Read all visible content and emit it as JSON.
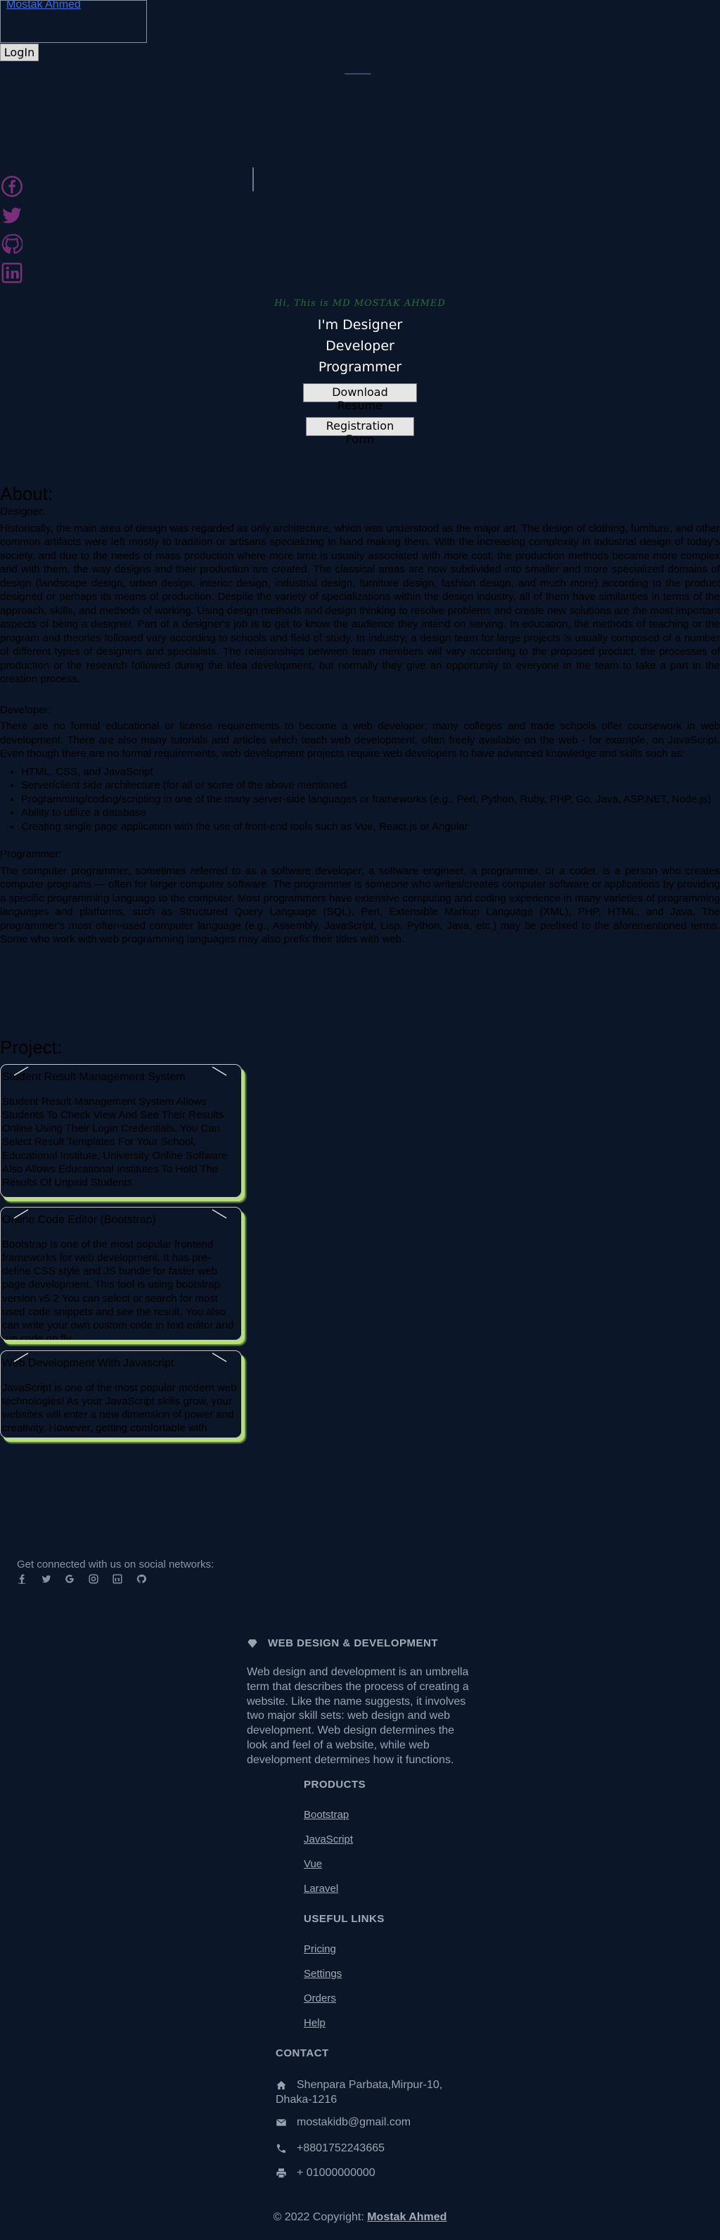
{
  "header": {
    "brand_link": "Mostak Ahmed",
    "login_label": "LogIn"
  },
  "hero": {
    "name_tagline": "Hi, This is MD MOSTAK AHMED",
    "roles": [
      "I'm Designer",
      "Developer",
      "Programmer"
    ],
    "download_resume_label": "Download Resume",
    "registration_form_label": "Registration Form"
  },
  "side_socials": [
    "facebook-icon",
    "twitter-icon",
    "github-icon",
    "linkedin-icon"
  ],
  "about": {
    "title": "About:",
    "designer_heading": "Designer:",
    "designer_text": "Historically, the main area of design was regarded as only architecture, which was understood as the major art. The design of clothing, furniture, and other common artifacts were left mostly to tradition or artisans specializing in hand making them. With the increasing complexity in industrial design of today's society, and due to the needs of mass production where more time is usually associated with more cost, the production methods became more complex and with them, the way designs and their production are created. The classical areas are now subdivided into smaller and more specialized domains of design (landscape design, urban design, interior design, industrial design, furniture design, fashion design, and much more) according to the product designed or perhaps its means of production. Despite the variety of specializations within the design industry, all of them have similarities in terms of the approach, skills, and methods of working. Using design methods and design thinking to resolve problems and create new solutions are the most important aspects of being a designer. Part of a designer's job is to get to know the audience they intend on serving. In education, the methods of teaching or the program and theories followed vary according to schools and field of study. In industry, a design team for large projects is usually composed of a number of different types of designers and specialists. The relationships between team members will vary according to the proposed product, the processes of production or the research followed during the idea development, but normally they give an opportunity to everyone in the team to take a part in the creation process.",
    "developer_heading": "Developer:",
    "developer_text": "There are no formal educational or license requirements to become a web developer; many colleges and trade schools offer coursework in web development. There are also many tutorials and articles which teach web development, often freely available on the web - for example, on JavaScript. Even though there are no formal requirements, web development projects require web developers to have advanced knowledge and skills such as:",
    "developer_list": [
      "HTML, CSS, and JavaScript",
      "Server/client side architecture (for all or some of the above mentioned",
      "Programming/coding/scripting in one of the many server-side languages or frameworks (e.g., Perl, Python, Ruby, PHP, Go, Java, ASP.NET, Node.js)",
      "Ability to utilize a database",
      "Creating single page application with the use of front-end tools such as Vue, React.js or Angular"
    ],
    "programmer_heading": "Programmer:",
    "programmer_text": "The computer programmer, sometimes referred to as a software developer, a software engineer, a programmer, or a coder, is a person who creates computer programs — often for larger computer software. The programmer is someone who writes/creates computer software or applications by providing a specific programming language to the computer. Most programmers have extensive computing and coding experience in many varieties of programming languages and platforms, such as Structured Query Language (SQL), Perl, Extensible Markup Language (XML), PHP, HTML, and Java. The programmer's most often-used computer language (e.g., Assembly, JavaScript, Lisp, Python, Java, etc.) may be prefixed to the aforementioned terms. Some who work with web programming languages may also prefix their titles with web."
  },
  "projects": {
    "title": "Project:",
    "cards": [
      {
        "title": "Student Result Management System",
        "body": "Student Result Management System Allows Students To Check View And See Their Results Online Using Their Login Credentials. You Can Select Result Templates For Your School, Educational Institute, University Online Software Also Allows Educational Institutes To Hold The Results Of Unpaid Students."
      },
      {
        "title": "Online Code Editor (Bootstrap)",
        "body": "Bootstrap is one of the most popular frontend frameworks for web development. It has pre-define CSS style and JS bundle for faster web page development. This tool is using bootstrap version v5.2 You can select or search for most used code snippets and see the result. You also can write your own custom code in text editor and run code on fly."
      },
      {
        "title": "Web Development With Javascript",
        "body": "JavaScript is one of the most popular modern web technologies! As your JavaScript skills grow, your websites will enter a new dimension of power and creativity. However, getting comfortable with JavaScript is more challenging than getting comfortable with HTML and CSS."
      }
    ]
  },
  "footer": {
    "connect_text": "Get connected with us on social networks:",
    "social_icons": [
      "facebook-icon",
      "twitter-icon",
      "google-icon",
      "instagram-icon",
      "linkedin-icon",
      "github-icon"
    ],
    "about_heading": "WEB DESIGN & DEVELOPMENT",
    "about_text": "Web design and development is an umbrella term that describes the process of creating a website. Like the name suggests, it involves two major skill sets: web design and web development. Web design determines the look and feel of a website, while web development determines how it functions.",
    "products_heading": "PRODUCTS",
    "products": [
      "Bootstrap",
      "JavaScript",
      "Vue",
      "Laravel"
    ],
    "useful_heading": "USEFUL LINKS",
    "useful_links": [
      "Pricing",
      "Settings",
      "Orders",
      "Help"
    ],
    "contact_heading": "CONTACT",
    "address": "Shenpara Parbata,Mirpur-10, Dhaka-1216",
    "email": "mostakidb@gmail.com",
    "phone": "+8801752243665",
    "fax": "+ 01000000000",
    "copyright_prefix": "© 2022 Copyright:",
    "copyright_name": "Mostak Ahmed"
  },
  "colors": {
    "background": "#0b1628",
    "card_shadow": "#b7e07d",
    "footer_text": "#9ba3b0"
  }
}
